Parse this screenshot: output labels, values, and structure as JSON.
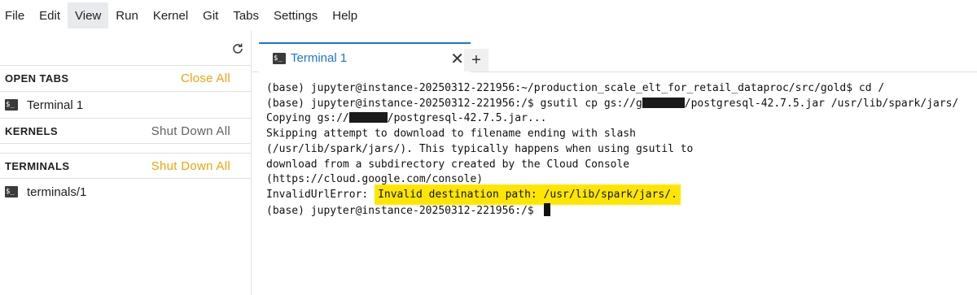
{
  "menu": {
    "items": [
      {
        "label": "File"
      },
      {
        "label": "Edit"
      },
      {
        "label": "View"
      },
      {
        "label": "Run"
      },
      {
        "label": "Kernel"
      },
      {
        "label": "Git"
      },
      {
        "label": "Tabs"
      },
      {
        "label": "Settings"
      },
      {
        "label": "Help"
      }
    ],
    "active": "View"
  },
  "sidebar": {
    "open_tabs": {
      "title": "OPEN TABS",
      "action": "Close All",
      "items": [
        {
          "label": "Terminal 1"
        }
      ]
    },
    "kernels": {
      "title": "KERNELS",
      "action": "Shut Down All"
    },
    "terminals": {
      "title": "TERMINALS",
      "action": "Shut Down All",
      "items": [
        {
          "label": "terminals/1"
        }
      ]
    }
  },
  "tabs": [
    {
      "label": "Terminal 1",
      "icon": "terminal-icon"
    }
  ],
  "terminal": {
    "lines": [
      {
        "text": "(base) jupyter@instance-20250312-221956:~/production_scale_elt_for_retail_dataproc/src/gold$ cd /"
      },
      {
        "pre": "(base) jupyter@instance-20250312-221956:/$ gsutil cp gs://g",
        "post": "/postgresql-42.7.5.jar /usr/lib/spark/jars/"
      },
      {
        "pre": "Copying gs://",
        "post": "/postgresql-42.7.5.jar..."
      },
      {
        "text": "Skipping attempt to download to filename ending with slash"
      },
      {
        "text": "(/usr/lib/spark/jars/). This typically happens when using gsutil to"
      },
      {
        "text": "download from a subdirectory created by the Cloud Console"
      },
      {
        "text": "(https://cloud.google.com/console)"
      },
      {
        "pre": "InvalidUrlError: ",
        "highlighted": "Invalid destination path: /usr/lib/spark/jars/."
      },
      {
        "text": "(base) jupyter@instance-20250312-221956:/$ "
      }
    ]
  },
  "colors": {
    "accent": "#1976d2",
    "action_orange": "#f0a30a",
    "highlight": "#ffe600"
  }
}
